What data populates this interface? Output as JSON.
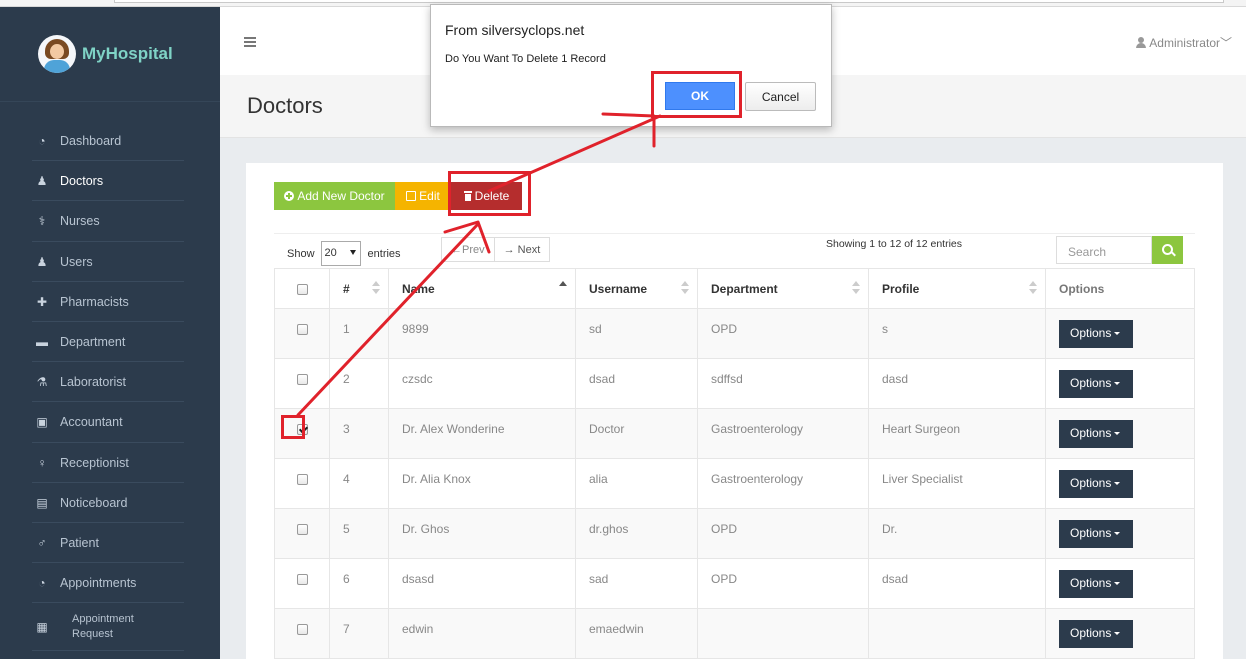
{
  "app": {
    "brand": "MyHospital"
  },
  "sidebar": {
    "items": [
      {
        "label": "Dashboard",
        "icon": "dashboard-icon",
        "glyph": "◔"
      },
      {
        "label": "Doctors",
        "icon": "user-icon",
        "glyph": "♟"
      },
      {
        "label": "Nurses",
        "icon": "stethoscope-icon",
        "glyph": "⚕"
      },
      {
        "label": "Users",
        "icon": "user-icon",
        "glyph": "♟"
      },
      {
        "label": "Pharmacists",
        "icon": "plus-square-icon",
        "glyph": "✚"
      },
      {
        "label": "Department",
        "icon": "briefcase-icon",
        "glyph": "▬"
      },
      {
        "label": "Laboratorist",
        "icon": "flask-icon",
        "glyph": "⚗"
      },
      {
        "label": "Accountant",
        "icon": "money-icon",
        "glyph": "▣"
      },
      {
        "label": "Receptionist",
        "icon": "female-icon",
        "glyph": "♀"
      },
      {
        "label": "Noticeboard",
        "icon": "file-icon",
        "glyph": "▤"
      },
      {
        "label": "Patient",
        "icon": "male-icon",
        "glyph": "♂"
      },
      {
        "label": "Appointments",
        "icon": "dashboard-icon",
        "glyph": "◔"
      },
      {
        "label": "Appointment Request",
        "icon": "list-icon",
        "glyph": "▦"
      }
    ]
  },
  "header": {
    "user": "Administrator"
  },
  "page": {
    "title": "Doctors"
  },
  "toolbar": {
    "add_label": "Add New Doctor",
    "edit_label": "Edit",
    "delete_label": "Delete"
  },
  "table_controls": {
    "show": "Show",
    "page_size": "20",
    "entries": "entries",
    "prev": "←Prev",
    "next": "→ Next",
    "info": "Showing 1 to 12 of 12 entries",
    "search_placeholder": "Search"
  },
  "table": {
    "columns": [
      "#",
      "Name",
      "Username",
      "Department",
      "Profile",
      "Options"
    ],
    "rows": [
      {
        "checked": false,
        "num": "1",
        "name": "9899",
        "username": "sd",
        "department": "OPD",
        "profile": "s"
      },
      {
        "checked": false,
        "num": "2",
        "name": "czsdc",
        "username": "dsad",
        "department": "sdffsd",
        "profile": "dasd"
      },
      {
        "checked": true,
        "num": "3",
        "name": "Dr. Alex Wonderine",
        "username": "Doctor",
        "department": "Gastroenterology",
        "profile": "Heart Surgeon"
      },
      {
        "checked": false,
        "num": "4",
        "name": "Dr. Alia Knox",
        "username": "alia",
        "department": "Gastroenterology",
        "profile": "Liver Specialist"
      },
      {
        "checked": false,
        "num": "5",
        "name": "Dr. Ghos",
        "username": "dr.ghos",
        "department": "OPD",
        "profile": "Dr."
      },
      {
        "checked": false,
        "num": "6",
        "name": "dsasd",
        "username": "sad",
        "department": "OPD",
        "profile": "dsad"
      },
      {
        "checked": false,
        "num": "7",
        "name": "edwin",
        "username": "emaedwin",
        "department": "",
        "profile": ""
      }
    ],
    "options_label": "Options"
  },
  "dialog": {
    "from": "From silversyclops.net",
    "message": "Do You Want To Delete 1 Record",
    "ok": "OK",
    "cancel": "Cancel"
  },
  "colors": {
    "sidebar": "#2c3b4c",
    "add": "#8cc63f",
    "edit": "#f5b400",
    "delete": "#b52d2d",
    "annotation": "#e0222b",
    "ok": "#4d90fe"
  }
}
